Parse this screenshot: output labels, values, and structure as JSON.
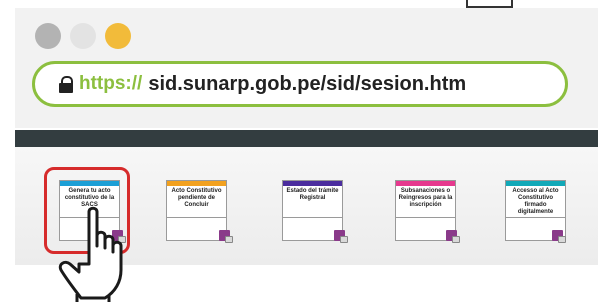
{
  "window": {
    "controls": [
      {
        "name": "close",
        "color": "#b3b3b3"
      },
      {
        "name": "minimize",
        "color": "#e3e3e3"
      },
      {
        "name": "maximize",
        "color": "#f2bb3a"
      }
    ]
  },
  "address_bar": {
    "protocol": "https://",
    "host_path": "sid.sunarp.gob.pe/sid/sesion.htm"
  },
  "colors": {
    "accent_green": "#8cbf3f",
    "highlight_red": "#d62b2b",
    "toolbar_dark": "#333d40"
  },
  "options": [
    {
      "label": "Genera tu acto constitutivo de la SACS",
      "color": "#1c9fd6"
    },
    {
      "label": "Acto Constitutivo pendiente de Concluir",
      "color": "#f2a11f"
    },
    {
      "label": "Estado del trámite Registral",
      "color": "#4b2d9e"
    },
    {
      "label": "Subsanaciones o Reingresos para la inscripción",
      "color": "#e6398e"
    },
    {
      "label": "Accesso al Acto Constitutivo firmado digitalmente",
      "color": "#12a9b8"
    }
  ]
}
